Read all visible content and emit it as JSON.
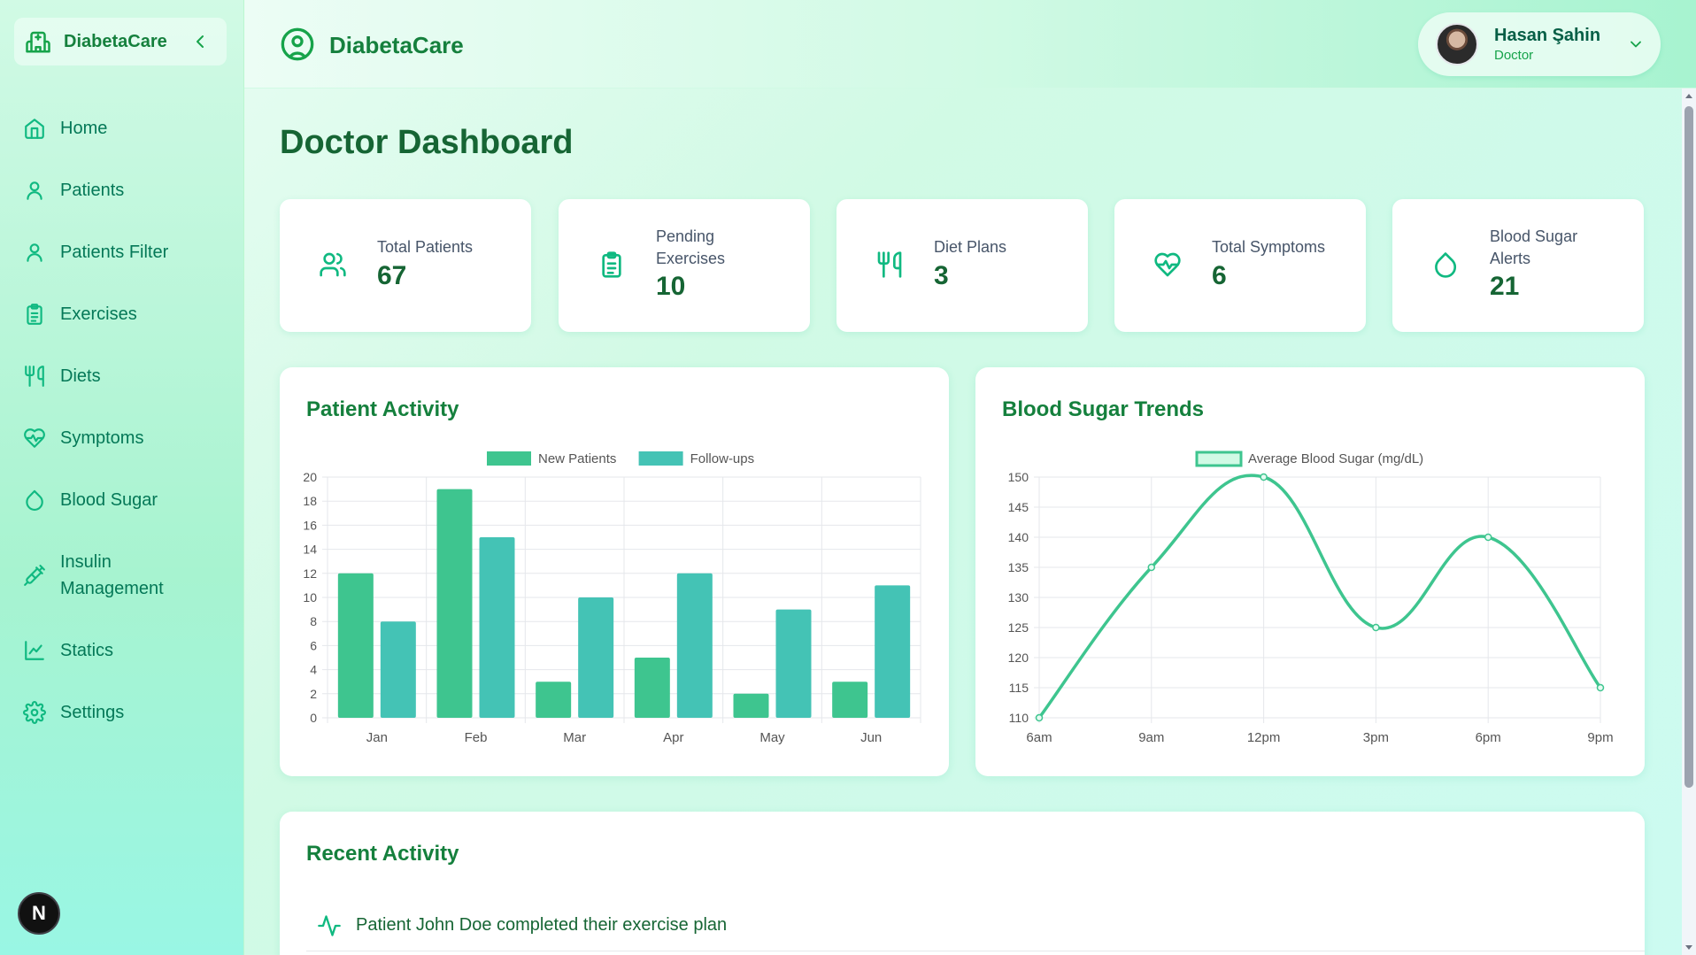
{
  "app": {
    "brand": "DiabetaCare",
    "header_title": "DiabetaCare"
  },
  "user": {
    "name": "Hasan Şahin",
    "role": "Doctor"
  },
  "sidebar": {
    "items": [
      {
        "label": "Home",
        "icon": "home-icon"
      },
      {
        "label": "Patients",
        "icon": "user-icon"
      },
      {
        "label": "Patients Filter",
        "icon": "user-icon"
      },
      {
        "label": "Exercises",
        "icon": "clipboard-icon"
      },
      {
        "label": "Diets",
        "icon": "utensils-icon"
      },
      {
        "label": "Symptoms",
        "icon": "heart-pulse-icon"
      },
      {
        "label": "Blood Sugar",
        "icon": "droplet-icon"
      },
      {
        "label": "Insulin Management",
        "icon": "syringe-icon"
      },
      {
        "label": "Statics",
        "icon": "line-chart-icon"
      },
      {
        "label": "Settings",
        "icon": "gear-icon"
      }
    ],
    "badge": "N"
  },
  "page": {
    "title": "Doctor Dashboard"
  },
  "stats": [
    {
      "label": "Total Patients",
      "value": "67",
      "icon": "users-icon"
    },
    {
      "label": "Pending Exercises",
      "value": "10",
      "icon": "clipboard-icon"
    },
    {
      "label": "Diet Plans",
      "value": "3",
      "icon": "utensils-icon"
    },
    {
      "label": "Total Symptoms",
      "value": "6",
      "icon": "heart-pulse-icon"
    },
    {
      "label": "Blood Sugar Alerts",
      "value": "21",
      "icon": "droplet-icon"
    }
  ],
  "panels": {
    "patient_activity_title": "Patient Activity",
    "blood_sugar_title": "Blood Sugar Trends",
    "recent_activity_title": "Recent Activity"
  },
  "recent_activity": [
    {
      "text": "Patient John Doe completed their exercise plan",
      "icon": "activity-icon"
    }
  ],
  "colors": {
    "primary": "#16a34a",
    "bar_new": "#3ec58f",
    "bar_follow": "#44c3b5",
    "line": "#3ec58f"
  },
  "chart_data": [
    {
      "type": "bar",
      "title": "Patient Activity",
      "categories": [
        "Jan",
        "Feb",
        "Mar",
        "Apr",
        "May",
        "Jun"
      ],
      "series": [
        {
          "name": "New Patients",
          "values": [
            12,
            19,
            3,
            5,
            2,
            3
          ]
        },
        {
          "name": "Follow-ups",
          "values": [
            8,
            15,
            10,
            12,
            9,
            11
          ]
        }
      ],
      "ylim": [
        0,
        20
      ],
      "yticks": [
        0,
        2,
        4,
        6,
        8,
        10,
        12,
        14,
        16,
        18,
        20
      ],
      "grid": true,
      "legend": "top"
    },
    {
      "type": "line",
      "title": "Blood Sugar Trends",
      "categories": [
        "6am",
        "9am",
        "12pm",
        "3pm",
        "6pm",
        "9pm"
      ],
      "series": [
        {
          "name": "Average Blood Sugar (mg/dL)",
          "values": [
            110,
            135,
            150,
            125,
            140,
            115
          ]
        }
      ],
      "ylim": [
        110,
        150
      ],
      "yticks": [
        110,
        115,
        120,
        125,
        130,
        135,
        140,
        145,
        150
      ],
      "grid": true,
      "legend": "top"
    }
  ]
}
